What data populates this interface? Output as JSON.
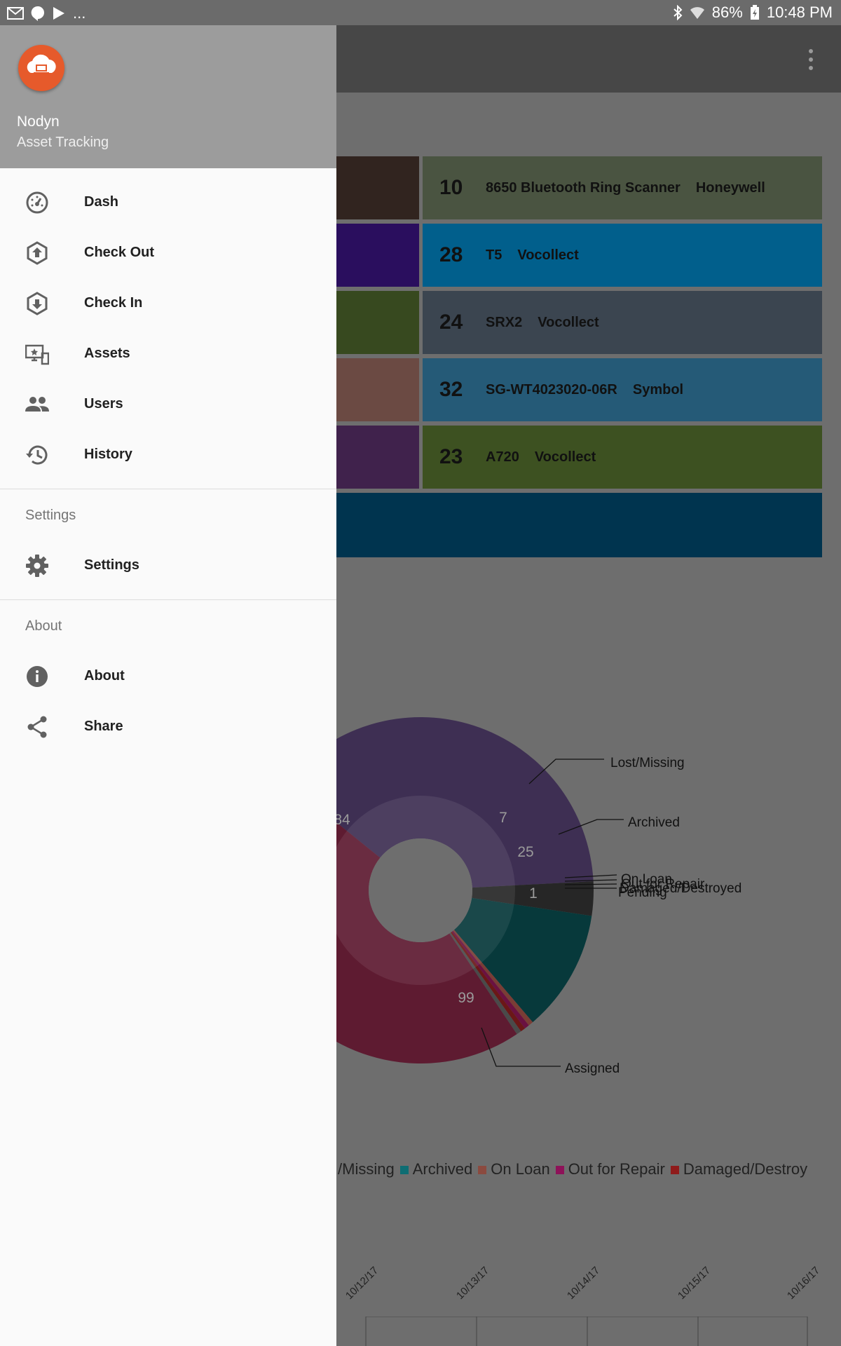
{
  "status_bar": {
    "left_ellipsis": "...",
    "battery": "86%",
    "time": "10:48 PM"
  },
  "drawer": {
    "app_name": "Nodyn",
    "app_subtitle": "Asset Tracking",
    "main_items": [
      {
        "label": "Dash",
        "icon": "speedometer-icon"
      },
      {
        "label": "Check Out",
        "icon": "upload-arrow-icon"
      },
      {
        "label": "Check In",
        "icon": "download-arrow-icon"
      },
      {
        "label": "Assets",
        "icon": "devices-icon"
      },
      {
        "label": "Users",
        "icon": "users-icon"
      },
      {
        "label": "History",
        "icon": "history-icon"
      }
    ],
    "settings_section": {
      "title": "Settings",
      "items": [
        {
          "label": "Settings",
          "icon": "gear-icon"
        }
      ]
    },
    "about_section": {
      "title": "About",
      "items": [
        {
          "label": "About",
          "icon": "info-icon"
        },
        {
          "label": "Share",
          "icon": "share-icon"
        }
      ]
    }
  },
  "asset_rows": [
    {
      "count": "10",
      "name": "8650 Bluetooth Ring Scanner",
      "make": "Honeywell",
      "color": "#4a5441",
      "tile_color": "#31241f"
    },
    {
      "count": "28",
      "name": "T5",
      "make": "Vocollect",
      "color": "#015f8c",
      "tile_color": "#2a0e5e"
    },
    {
      "count": "24",
      "name": "SRX2",
      "make": "Vocollect",
      "color": "#3b4550",
      "tile_color": "#37491f"
    },
    {
      "count": "32",
      "name": "SG-WT4023020-06R",
      "make": "Symbol",
      "color": "#255a77",
      "tile_color": "#6b4a43"
    },
    {
      "count": "23",
      "name": "A720",
      "make": "Vocollect",
      "color": "#3d5121",
      "tile_color": "#40224c"
    }
  ],
  "chart_data": {
    "type": "pie",
    "donut": true,
    "categories": [
      "Assigned",
      "Archived",
      "Lost/Missing",
      "On Loan",
      "Out for Repair",
      "Damaged/Destroyed",
      "Pending"
    ],
    "values": [
      99,
      25,
      7,
      1,
      1,
      1,
      1
    ],
    "partial_value": "84",
    "slice_colors": [
      "#5e1b31",
      "#07393b",
      "#262626",
      "#7a3d35",
      "#6a1141",
      "#6b1717",
      "#4a4a4a"
    ],
    "legend_items": [
      {
        "label": "/Missing",
        "color": ""
      },
      {
        "label": "Archived",
        "color": "#0e6d73"
      },
      {
        "label": "On Loan",
        "color": "#8b4a3f"
      },
      {
        "label": "Out for Repair",
        "color": "#8e1259"
      },
      {
        "label": "Damaged/Destroy",
        "color": "#8f1b1b"
      }
    ],
    "x_ticks": [
      "10/12/17",
      "10/13/17",
      "10/14/17",
      "10/15/17",
      "10/16/17"
    ]
  }
}
